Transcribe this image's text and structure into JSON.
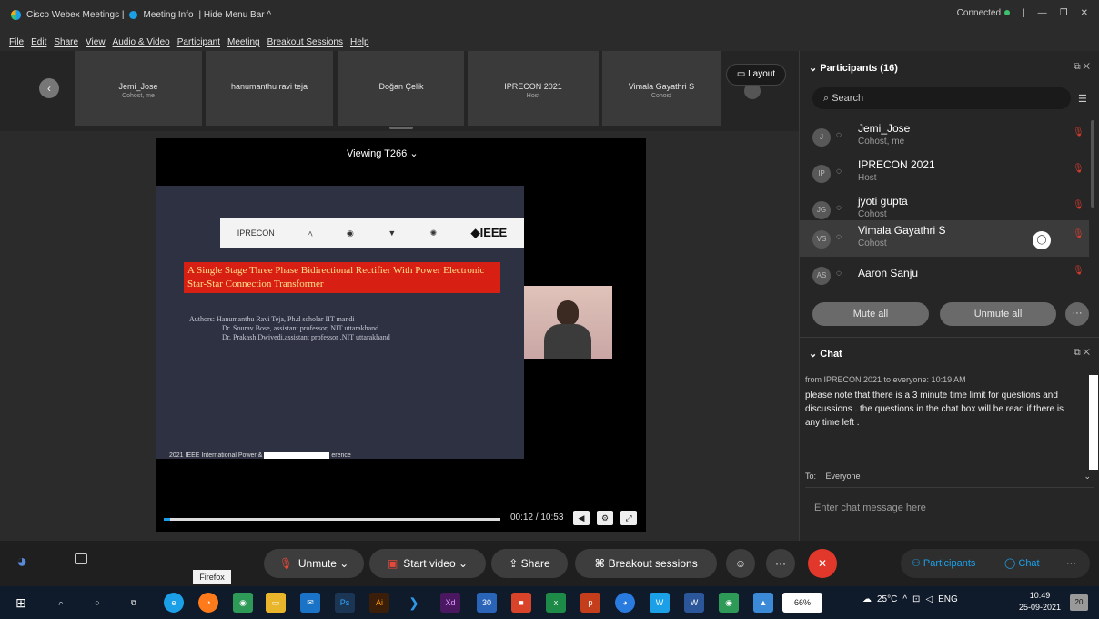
{
  "titlebar": {
    "app": "Cisco Webex Meetings |",
    "meeting_info": "Meeting Info",
    "hide_menu": "| Hide Menu Bar ^",
    "status": "Connected",
    "minimize": "—",
    "restore": "❐",
    "close": "✕"
  },
  "menu": [
    "File",
    "Edit",
    "Share",
    "View",
    "Audio & Video",
    "Participant",
    "Meeting",
    "Breakout Sessions",
    "Help"
  ],
  "thumbs": [
    {
      "name": "Jemi_Jose",
      "role": "Cohost, me"
    },
    {
      "name": "hanumanthu ravi teja",
      "role": ""
    },
    {
      "name": "Doğan Çelik",
      "role": ""
    },
    {
      "name": "IPRECON 2021",
      "role": "Host"
    },
    {
      "name": "Vimala Gayathri S",
      "role": "Cohost"
    }
  ],
  "layout_label": "Layout",
  "video": {
    "viewing": "Viewing T266",
    "slide_logos": {
      "iprecon": "IPRECON",
      "ieee": "◆IEEE"
    },
    "slide_title": "A Single Stage Three Phase Bidirectional Rectifier With Power Electronic Star-Star Connection Transformer",
    "authors": [
      "Authors: Hanumanthu Ravi Teja, Ph.d scholar IIT mandi",
      "Dr. Sourav Bose, assistant professor, NIT uttarakhand",
      "Dr. Prakash Dwivedi,assistant professor ,NIT uttarakhand"
    ],
    "conference_left": "2021 IEEE International Power &",
    "conference_right": "erence",
    "timecode": "00:12 / 10:53",
    "progress": 0.02
  },
  "participants": {
    "header": "Participants (16)",
    "search_placeholder": "Search",
    "rows": [
      {
        "initials": "J",
        "name": "Jemi_Jose",
        "role": "Cohost, me"
      },
      {
        "initials": "IP",
        "name": "IPRECON 2021",
        "role": "Host"
      },
      {
        "initials": "JG",
        "name": "jyoti gupta",
        "role": "Cohost"
      },
      {
        "initials": "VS",
        "name": "Vimala Gayathri S",
        "role": "Cohost"
      },
      {
        "initials": "AS",
        "name": "Aaron Sanju",
        "role": ""
      }
    ],
    "mute_all": "Mute all",
    "unmute_all": "Unmute all"
  },
  "chat": {
    "header": "Chat",
    "meta": "from IPRECON 2021 to everyone:   10:19 AM",
    "message": "please note that there is a 3 minute time limit for questions and discussions . the questions in the chat box will be read if there is any time left .",
    "to_label": "To:",
    "to_value": "Everyone",
    "input_placeholder": "Enter chat message here"
  },
  "controls": {
    "unmute": "Unmute",
    "start_video": "Start video",
    "share": "Share",
    "breakout": "Breakout sessions",
    "participants": "Participants",
    "chat": "Chat",
    "tooltip": "Firefox"
  },
  "taskbar": {
    "battery": "66%",
    "temp": "25°C",
    "lang": "ENG",
    "time": "10:49",
    "date": "25-09-2021",
    "notifications": "20"
  }
}
